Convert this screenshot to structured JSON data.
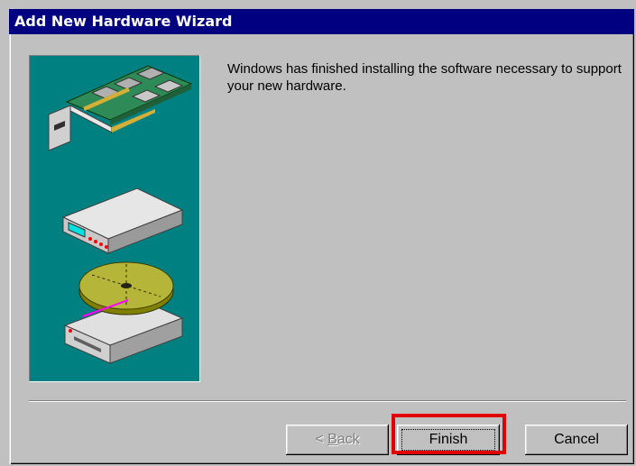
{
  "window": {
    "title": "Add New Hardware Wizard"
  },
  "content": {
    "message": "Windows has finished installing the software necessary to support your new hardware."
  },
  "buttons": {
    "back_prefix": "< ",
    "back_mnemonic": "B",
    "back_rest": "ack",
    "finish": "Finish",
    "cancel": "Cancel"
  },
  "icons": [
    "expansion-card-icon",
    "modem-icon",
    "disk-drive-icon"
  ],
  "colors": {
    "title_bar": "#000080",
    "panel": "#008080",
    "highlight": "#e00000",
    "face": "#c0c0c0"
  }
}
